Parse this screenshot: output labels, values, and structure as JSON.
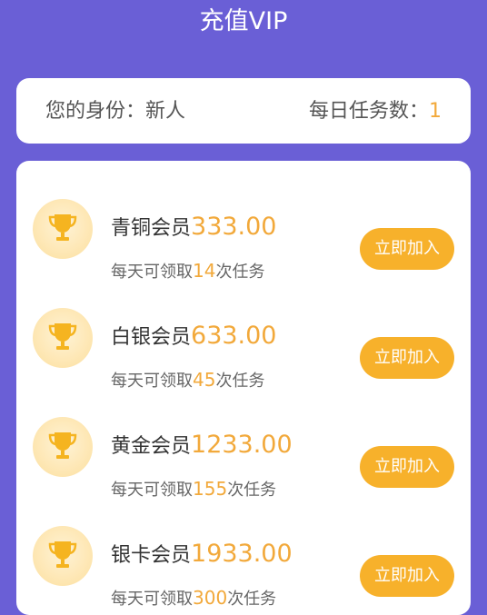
{
  "header": {
    "title": "充值VIP"
  },
  "identity": {
    "label": "您的身份：",
    "value": "新人",
    "task_label": "每日任务数：",
    "task_value": "1"
  },
  "plans": [
    {
      "name": "青铜会员",
      "price": "333.00",
      "desc_prefix": "每天可领取",
      "count": "14",
      "desc_suffix": "次任务",
      "button": "立即加入",
      "icon": "trophy-icon"
    },
    {
      "name": "白银会员",
      "price": "633.00",
      "desc_prefix": "每天可领取",
      "count": "45",
      "desc_suffix": "次任务",
      "button": "立即加入",
      "icon": "trophy-icon"
    },
    {
      "name": "黄金会员",
      "price": "1233.00",
      "desc_prefix": "每天可领取",
      "count": "155",
      "desc_suffix": "次任务",
      "button": "立即加入",
      "icon": "trophy-icon"
    },
    {
      "name": "银卡会员",
      "price": "1933.00",
      "desc_prefix": "每天可领取",
      "count": "300",
      "desc_suffix": "次任务",
      "button": "立即加入",
      "icon": "trophy-icon"
    }
  ],
  "colors": {
    "background": "#6a5fd6",
    "accent": "#f2a93b",
    "button": "#f7b12b"
  }
}
